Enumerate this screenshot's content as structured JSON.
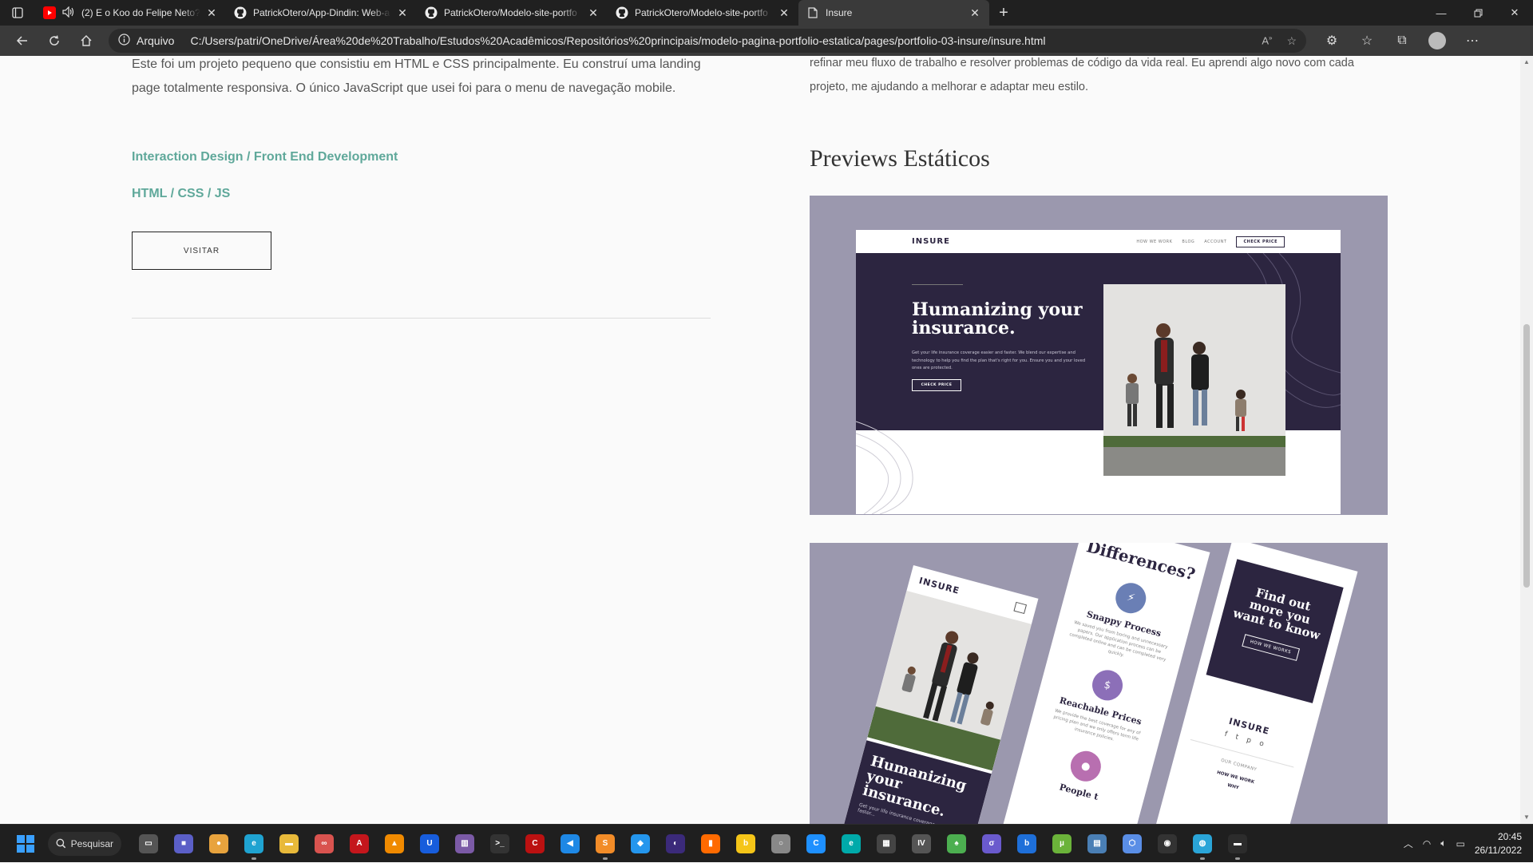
{
  "browser": {
    "tabs": [
      {
        "title": "(2) E o Koo do Felipe Neto?",
        "icon": "youtube-icon",
        "active": false
      },
      {
        "title": "PatrickOtero/App-Dindin: Web-a",
        "icon": "github-icon",
        "active": false
      },
      {
        "title": "PatrickOtero/Modelo-site-portfo",
        "icon": "github-icon",
        "active": false
      },
      {
        "title": "PatrickOtero/Modelo-site-portfo",
        "icon": "github-icon",
        "active": false
      },
      {
        "title": "Insure",
        "icon": "page-icon",
        "active": true
      }
    ],
    "address": {
      "label": "Arquivo",
      "url": "C:/Users/patri/OneDrive/Área%20de%20Trabalho/Estudos%20Acadêmicos/Repositórios%20principais/modelo-pagina-portfolio-estatica/pages/portfolio-03-insure/insure.html"
    }
  },
  "page": {
    "left": {
      "description": "Este foi um projeto pequeno que consistiu em HTML e CSS principalmente. Eu construí uma landing page totalmente responsiva. O único JavaScript que usei foi para o menu de navegação mobile.",
      "role": "Interaction Design / Front End Development",
      "stack": "HTML / CSS / JS",
      "visit_label": "VISITAR"
    },
    "right": {
      "text": "refinar meu fluxo de trabalho e resolver problemas de código da vida real. Eu aprendi algo novo com cada projeto, me ajudando a melhorar e adaptar meu estilo.",
      "previews_title": "Previews Estáticos"
    },
    "preview1": {
      "logo": "INSURE",
      "nav": [
        "HOW WE WORK",
        "BLOG",
        "ACCOUNT"
      ],
      "cta": "CHECK PRICE",
      "headline": "Humanizing your insurance.",
      "body": "Get your life insurance coverage easier and faster. We blend our expertise and technology to help you find the plan that's right for you. Ensure you and your loved ones are protected.",
      "button": "CHECK PRICE"
    },
    "preview2": {
      "logo": "INSURE",
      "headline": "Humanizing your insurance.",
      "body": "Get your life insurance coverage easier and faster...",
      "differences": "Differences?",
      "features": [
        {
          "title": "Snappy Process",
          "text": "We saved you from boring and unnecessary papers. Our application process can be completed online and can be completed very quickly."
        },
        {
          "title": "Reachable Prices",
          "text": "We provide the best coverage for any of pricing plan and we only offers term life insurance policies."
        },
        {
          "title": "People t",
          "text": ""
        }
      ],
      "cta_title": "Find out more you want to know",
      "cta_button": "HOW WE WORKS",
      "footer_logo": "INSURE",
      "footer_section": "OUR COMPANY",
      "footer_links": [
        "HOW WE WORK",
        "WHY"
      ]
    }
  },
  "taskbar": {
    "search": "Pesquisar",
    "time": "20:45",
    "date": "26/11/2022",
    "apps": [
      {
        "name": "task-view",
        "color": "#555",
        "glyph": "▭",
        "open": false
      },
      {
        "name": "teams",
        "color": "#5b5fc7",
        "glyph": "■",
        "open": false
      },
      {
        "name": "chrome",
        "color": "#e8a33d",
        "glyph": "●",
        "open": false
      },
      {
        "name": "edge",
        "color": "#1fa3d1",
        "glyph": "e",
        "open": true
      },
      {
        "name": "file-explorer",
        "color": "#e8b93a",
        "glyph": "▬",
        "open": false
      },
      {
        "name": "app-red",
        "color": "#d9534f",
        "glyph": "∞",
        "open": false
      },
      {
        "name": "acrobat",
        "color": "#c4161c",
        "glyph": "A",
        "open": false
      },
      {
        "name": "vlc",
        "color": "#f08a00",
        "glyph": "▲",
        "open": false
      },
      {
        "name": "bitwarden",
        "color": "#175ddc",
        "glyph": "U",
        "open": false
      },
      {
        "name": "winrar",
        "color": "#7b5aa6",
        "glyph": "▥",
        "open": false
      },
      {
        "name": "terminal",
        "color": "#333",
        "glyph": ">_",
        "open": false
      },
      {
        "name": "dev-cpp",
        "color": "#b11",
        "glyph": "C",
        "open": false
      },
      {
        "name": "vscode",
        "color": "#1e88e5",
        "glyph": "◀",
        "open": false
      },
      {
        "name": "sublime",
        "color": "#f28c28",
        "glyph": "S",
        "open": true
      },
      {
        "name": "docker",
        "color": "#2496ed",
        "glyph": "◆",
        "open": false
      },
      {
        "name": "eclipse",
        "color": "#3b2a7a",
        "glyph": "◐",
        "open": false
      },
      {
        "name": "app-bars",
        "color": "#ff6a00",
        "glyph": "▮",
        "open": false
      },
      {
        "name": "app-yellow",
        "color": "#f5c518",
        "glyph": "b",
        "open": false
      },
      {
        "name": "search-app",
        "color": "#888",
        "glyph": "○",
        "open": false
      },
      {
        "name": "app-blue",
        "color": "#1e90ff",
        "glyph": "C",
        "open": false
      },
      {
        "name": "app-arc",
        "color": "#0aa",
        "glyph": "e",
        "open": false
      },
      {
        "name": "app-hash",
        "color": "#444",
        "glyph": "▦",
        "open": false
      },
      {
        "name": "app-iv",
        "color": "#555",
        "glyph": "IV",
        "open": false
      },
      {
        "name": "app-leaf",
        "color": "#4caf50",
        "glyph": "♠",
        "open": false
      },
      {
        "name": "app-purple",
        "color": "#6a5acd",
        "glyph": "σ",
        "open": false
      },
      {
        "name": "app-blue2",
        "color": "#1e6fd9",
        "glyph": "b",
        "open": false
      },
      {
        "name": "utorrent",
        "color": "#6bb33a",
        "glyph": "µ",
        "open": false
      },
      {
        "name": "app-chart",
        "color": "#4a7fb5",
        "glyph": "▤",
        "open": false
      },
      {
        "name": "app-cube",
        "color": "#5a8ee6",
        "glyph": "⬡",
        "open": false
      },
      {
        "name": "app-dark",
        "color": "#333",
        "glyph": "◉",
        "open": false
      },
      {
        "name": "app-globe",
        "color": "#2aa5d8",
        "glyph": "◍",
        "open": true
      },
      {
        "name": "app-console",
        "color": "#2c2c2c",
        "glyph": "▬",
        "open": true
      }
    ]
  }
}
